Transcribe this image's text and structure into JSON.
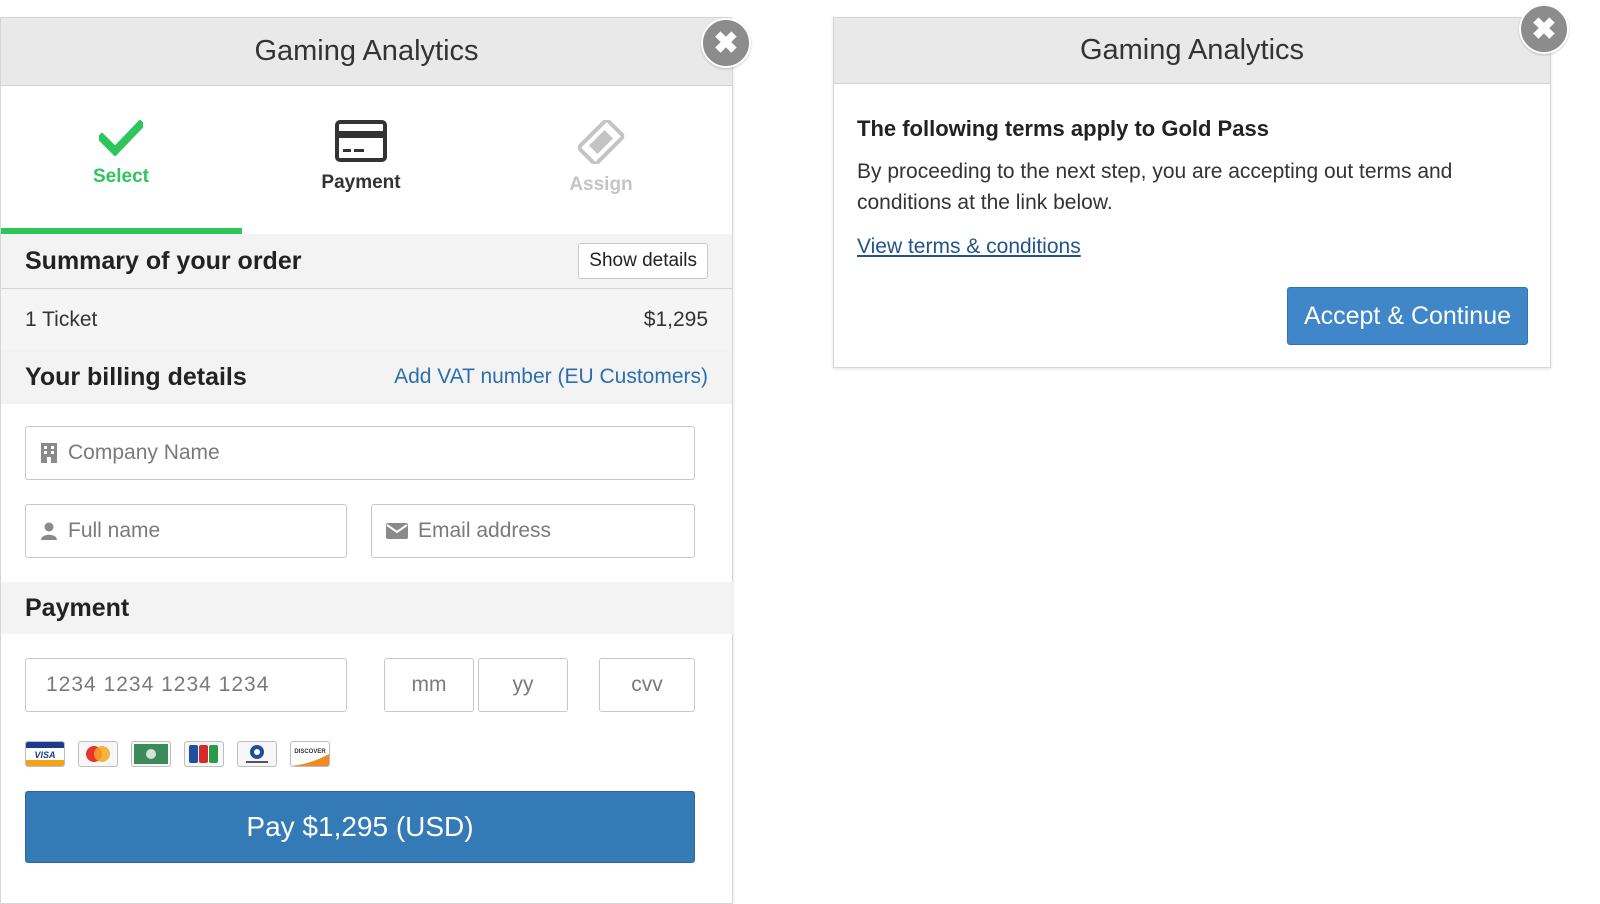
{
  "checkout": {
    "title": "Gaming Analytics",
    "close_label": "✖",
    "steps": [
      {
        "label": "Select",
        "state": "done",
        "icon": "check-icon"
      },
      {
        "label": "Payment",
        "state": "current",
        "icon": "credit-card-icon"
      },
      {
        "label": "Assign",
        "state": "pending",
        "icon": "ticket-icon"
      }
    ],
    "summary": {
      "title": "Summary of your order",
      "show_details_label": "Show details",
      "item_label": "1 Ticket",
      "item_price": "$1,295"
    },
    "billing": {
      "title": "Your billing details",
      "vat_link": "Add VAT number (EU Customers)",
      "company_placeholder": "Company Name",
      "fullname_placeholder": "Full name",
      "email_placeholder": "Email address"
    },
    "payment": {
      "title": "Payment",
      "card_number_placeholder": "1234 1234 1234 1234",
      "month_placeholder": "mm",
      "year_placeholder": "yy",
      "cvv_placeholder": "cvv",
      "card_brands": [
        "VISA",
        "MasterCard",
        "AMEX",
        "JCB",
        "Diners Club",
        "DISCOVER"
      ],
      "pay_label": "Pay $1,295 (USD)"
    }
  },
  "terms": {
    "title": "Gaming Analytics",
    "close_label": "✖",
    "heading": "The following terms apply to Gold Pass",
    "body": "By proceeding to the next step, you are accepting out terms and conditions at the link below.",
    "link": "View terms & conditions",
    "accept_label": "Accept & Continue"
  },
  "colors": {
    "accent_green": "#2fc55d",
    "primary_blue": "#337ab7",
    "link_blue": "#2b6fae"
  }
}
